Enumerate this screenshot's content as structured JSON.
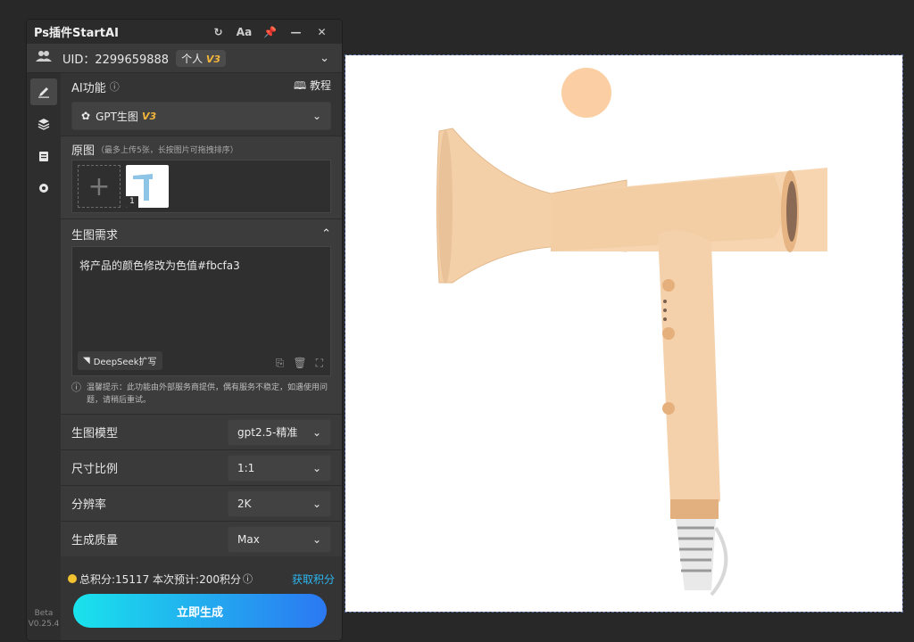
{
  "panel": {
    "title": "Ps插件StartAI",
    "titlebar_buttons": [
      "refresh-icon",
      "font-icon",
      "pin-icon",
      "minimize-icon",
      "close-icon"
    ],
    "font_button": "Aa",
    "uid": "UID：2299659888",
    "plan": "个人",
    "plan_badge": "V3"
  },
  "sidebar": {
    "items": [
      "brush-icon",
      "layers-icon",
      "clipboard-icon",
      "gear-icon"
    ],
    "version_line1": "Beta",
    "version_line2": "V0.25.4"
  },
  "ai_function": {
    "label": "AI功能",
    "tutorial": "教程",
    "selected": "GPT生图",
    "selected_badge": "V3"
  },
  "source_images": {
    "label": "原图",
    "hint": "（最多上传5张，长按图片可拖拽排序）",
    "count_label": "1"
  },
  "prompt": {
    "label": "生图需求",
    "text": "将产品的颜色修改为色值#fbcfa3",
    "deepseek": "DeepSeek扩写"
  },
  "tip": "温馨提示：此功能由外部服务商提供，偶有服务不稳定，如遇使用问题，请稍后重试。",
  "settings": {
    "model_label": "生图模型",
    "model_value": "gpt2.5-精准",
    "ratio_label": "尺寸比例",
    "ratio_value": "1:1",
    "resolution_label": "分辨率",
    "resolution_value": "2K",
    "quality_label": "生成质量",
    "quality_value": "Max"
  },
  "footer": {
    "credits": "总积分:15117 本次预计:200积分",
    "get_credits": "获取积分",
    "generate": "立即生成"
  },
  "canvas": {
    "swatch_color": "#fbcfa3",
    "product_color": "#f5d2ad"
  }
}
